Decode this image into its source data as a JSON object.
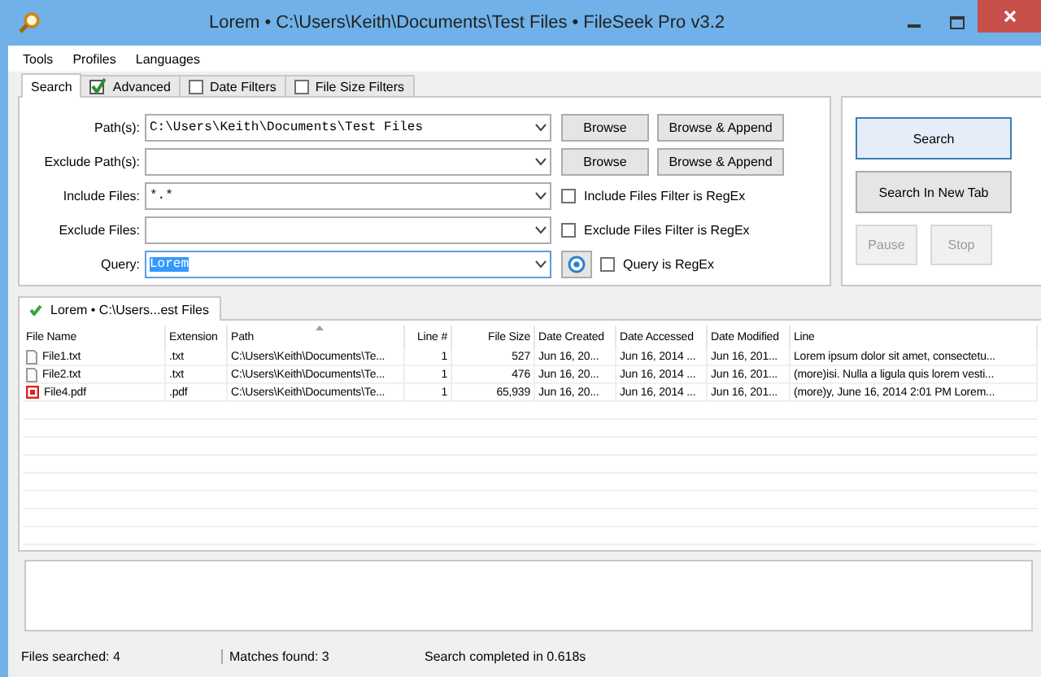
{
  "window": {
    "title": "Lorem • C:\\Users\\Keith\\Documents\\Test Files • FileSeek Pro v3.2"
  },
  "menu": [
    "Tools",
    "Profiles",
    "Languages"
  ],
  "tabs": [
    {
      "label": "Search",
      "kind": "plain",
      "selected": true
    },
    {
      "label": "Advanced",
      "kind": "checkbox",
      "checked": true,
      "selected": false
    },
    {
      "label": "Date Filters",
      "kind": "checkbox",
      "checked": false,
      "selected": false
    },
    {
      "label": "File Size Filters",
      "kind": "checkbox",
      "checked": false,
      "selected": false
    }
  ],
  "fields": [
    {
      "label": "Path(s):",
      "value": "C:\\Users\\Keith\\Documents\\Test Files",
      "kind": "buttons",
      "buttons": [
        "Browse",
        "Browse & Append"
      ]
    },
    {
      "label": "Exclude Path(s):",
      "kind": "buttons",
      "buttons": [
        "Browse",
        "Browse & Append"
      ]
    },
    {
      "label": "Include Files:",
      "value": "*.*",
      "kind": "checkbox",
      "option": {
        "label": "Include Files Filter is RegEx",
        "checked": false
      }
    },
    {
      "label": "Exclude Files:",
      "kind": "checkbox",
      "option": {
        "label": "Exclude Files Filter is RegEx",
        "checked": false
      }
    },
    {
      "label": "Query:",
      "value": "Lorem",
      "focused": true,
      "text_selected": true,
      "kind": "help",
      "option": {
        "label": "Query is RegEx",
        "checked": false
      }
    }
  ],
  "actions": [
    {
      "label": "Search",
      "default": true,
      "disabled": false
    },
    {
      "label": "Search In New Tab",
      "default": false,
      "disabled": false
    },
    {
      "label": "Pause",
      "default": false,
      "disabled": true
    },
    {
      "label": "Stop",
      "default": false,
      "disabled": true
    }
  ],
  "result_tab": {
    "label": "Lorem • C:\\Users...est Files"
  },
  "table": {
    "columns": [
      {
        "label": "File Name",
        "kind": "text",
        "sorted": false
      },
      {
        "label": "Extension",
        "kind": "text",
        "sorted": false
      },
      {
        "label": "Path",
        "kind": "text",
        "sorted": true
      },
      {
        "label": "Line #",
        "kind": "number",
        "sorted": false
      },
      {
        "label": "File Size",
        "kind": "number",
        "sorted": false
      },
      {
        "label": "Date Created",
        "kind": "text",
        "sorted": false
      },
      {
        "label": "Date Accessed",
        "kind": "text",
        "sorted": false
      },
      {
        "label": "Date Modified",
        "kind": "text",
        "sorted": false
      },
      {
        "label": "Line",
        "kind": "text",
        "sorted": false
      }
    ],
    "rows": [
      {
        "kind": "text",
        "cells": [
          "File1.txt",
          ".txt",
          "C:\\Users\\Keith\\Documents\\Te...",
          "1",
          "527",
          "Jun 16, 20...",
          "Jun 16, 2014 ...",
          "Jun 16, 201...",
          "Lorem ipsum dolor sit amet, consectetu..."
        ]
      },
      {
        "kind": "text",
        "cells": [
          "File2.txt",
          ".txt",
          "C:\\Users\\Keith\\Documents\\Te...",
          "1",
          "476",
          "Jun 16, 20...",
          "Jun 16, 2014 ...",
          "Jun 16, 201...",
          "(more)isi. Nulla a ligula quis lorem vesti..."
        ]
      },
      {
        "kind": "pdf",
        "cells": [
          "File4.pdf",
          ".pdf",
          "C:\\Users\\Keith\\Documents\\Te...",
          "1",
          "65,939",
          "Jun 16, 20...",
          "Jun 16, 2014 ...",
          "Jun 16, 201...",
          "(more)y, June 16, 2014 2:01 PM Lorem..."
        ]
      }
    ]
  },
  "status_bar": [
    "Files searched: 4",
    "Matches found: 3",
    "Search completed in 0.618s"
  ]
}
